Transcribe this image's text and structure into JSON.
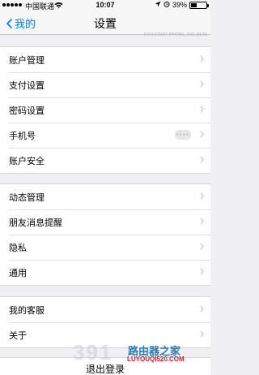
{
  "status_bar": {
    "carrier": "中国联通",
    "time": "10:07",
    "battery_percent": "39%",
    "battery_level": 0.39
  },
  "nav": {
    "back_label": "我的",
    "title": "设置",
    "version": "9.9.0.073007,IPHONE_1ND_BETA"
  },
  "sections": [
    {
      "items": [
        {
          "label": "账户管理"
        },
        {
          "label": "支付设置"
        },
        {
          "label": "密码设置"
        },
        {
          "label": "手机号",
          "value": "••••"
        },
        {
          "label": "账户安全"
        }
      ]
    },
    {
      "items": [
        {
          "label": "动态管理"
        },
        {
          "label": "朋友消息提醒"
        },
        {
          "label": "隐私"
        },
        {
          "label": "通用"
        }
      ]
    },
    {
      "items": [
        {
          "label": "我的客服"
        },
        {
          "label": "关于"
        }
      ]
    }
  ],
  "logout_label": "退出登录",
  "watermark": {
    "number": "391",
    "brand": "路由器之家",
    "url": "LUYOUQI520.COM"
  }
}
